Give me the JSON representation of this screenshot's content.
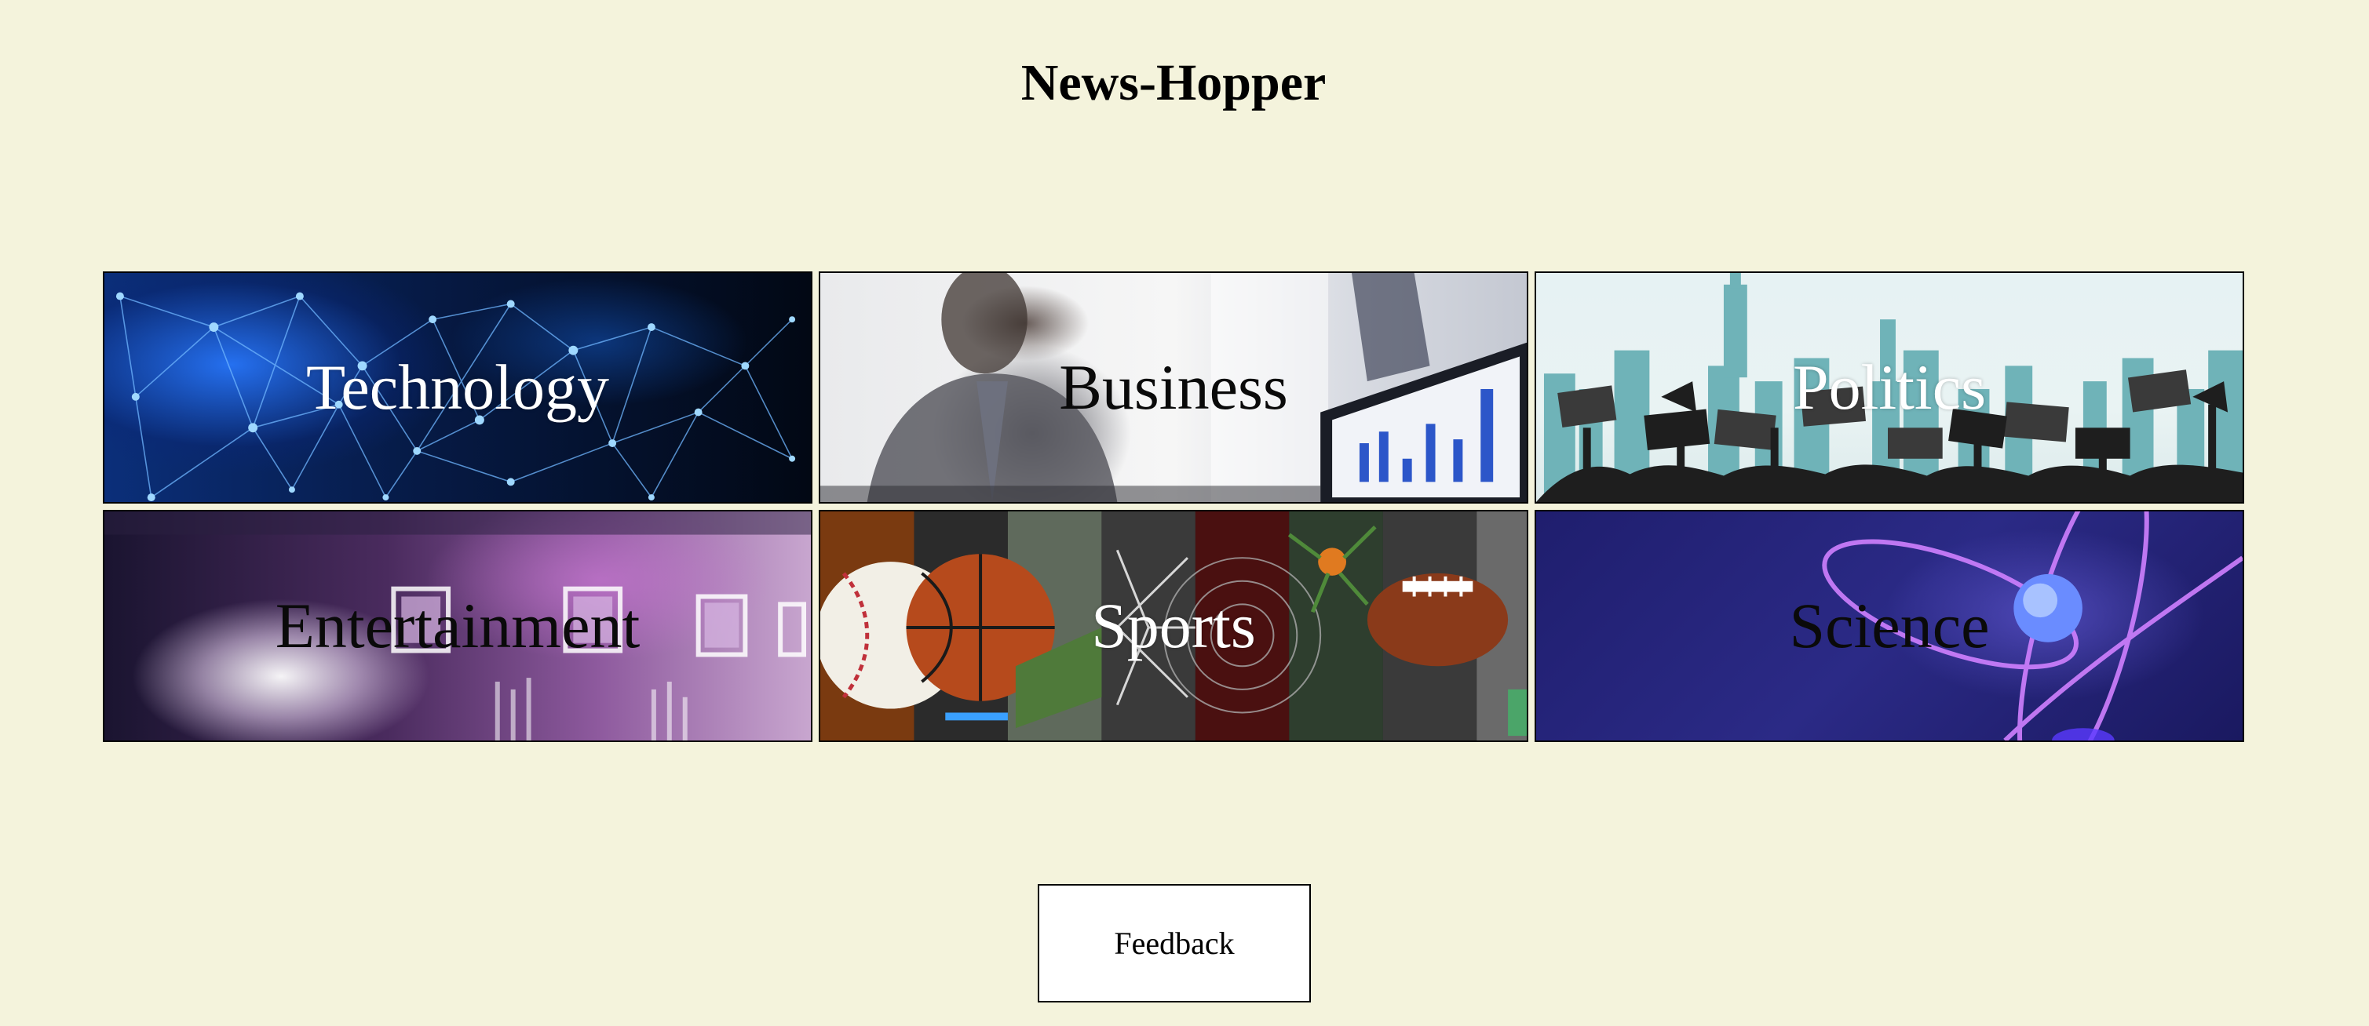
{
  "header": {
    "title": "News-Hopper"
  },
  "categories": [
    {
      "label": "Technology",
      "icon": "network-nodes-image"
    },
    {
      "label": "Business",
      "icon": "business-meeting-image"
    },
    {
      "label": "Politics",
      "icon": "protest-crowd-image"
    },
    {
      "label": "Entertainment",
      "icon": "concert-stage-image"
    },
    {
      "label": "Sports",
      "icon": "sports-balls-collage-image"
    },
    {
      "label": "Science",
      "icon": "atom-orbit-image"
    }
  ],
  "footer": {
    "feedback_label": "Feedback"
  },
  "colors": {
    "page_background": "#f4f3dc",
    "button_background": "#ffffff",
    "border": "#000000"
  }
}
